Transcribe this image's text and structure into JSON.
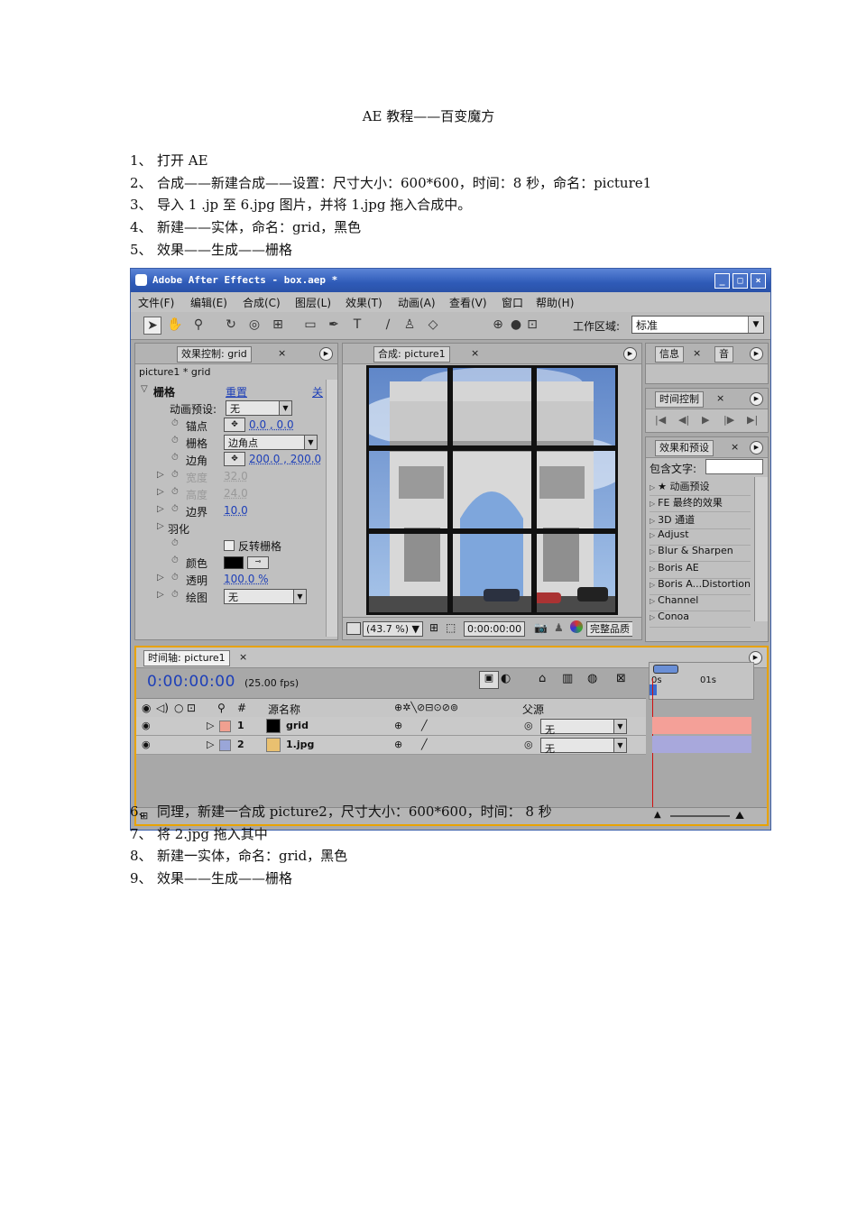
{
  "doc": {
    "title": "AE 教程——百变魔方",
    "steps_top": [
      {
        "num": "1、",
        "text": "打开 AE"
      },
      {
        "num": "2、",
        "text": "合成——新建合成——设置：尺寸大小：600*600，时间：8 秒，命名：picture1"
      },
      {
        "num": "3、",
        "text": "导入 1 .jp 至 6.jpg 图片，并将 1.jpg 拖入合成中。"
      },
      {
        "num": "4、",
        "text": "新建——实体，命名：grid，黑色"
      },
      {
        "num": "5、",
        "text": "效果——生成——栅格"
      }
    ],
    "steps_bottom": [
      {
        "num": "6、",
        "text": "同理，新建一合成 picture2，尺寸大小：600*600，时间： 8 秒"
      },
      {
        "num": "7、",
        "text": "将 2.jpg 拖入其中"
      },
      {
        "num": "8、",
        "text": "新建一实体，命名：grid，黑色"
      },
      {
        "num": "9、",
        "text": "效果——生成——栅格"
      }
    ]
  },
  "ae": {
    "window_title": "Adobe After Effects - box.aep *",
    "menu": [
      "文件(F)",
      "编辑(E)",
      "合成(C)",
      "图层(L)",
      "效果(T)",
      "动画(A)",
      "查看(V)",
      "窗口",
      "帮助(H)"
    ],
    "workspace_label": "工作区域:",
    "workspace_value": "标准",
    "effect_controls": {
      "tab": "效果控制: grid",
      "layer_path": "picture1 * grid",
      "effect_name": "栅格",
      "reset": "重置",
      "about": "关",
      "preset_label": "动画预设:",
      "preset_value": "无",
      "props": [
        {
          "name": "锚点",
          "value": "0.0 , 0.0",
          "dim": false
        },
        {
          "name": "栅格",
          "value": "边角点",
          "dim": false
        },
        {
          "name": "边角",
          "value": "200.0 , 200.0",
          "dim": false
        },
        {
          "name": "宽度",
          "value": "32.0",
          "dim": true
        },
        {
          "name": "高度",
          "value": "24.0",
          "dim": true
        },
        {
          "name": "边界",
          "value": "10.0",
          "dim": false
        },
        {
          "name": "羽化",
          "value": "",
          "dim": false
        },
        {
          "name": "反转栅格",
          "value": "",
          "dim": false
        },
        {
          "name": "颜色",
          "value": "",
          "dim": false
        },
        {
          "name": "透明",
          "value": "100.0 %",
          "dim": false
        },
        {
          "name": "绘图",
          "value": "无",
          "dim": false
        }
      ]
    },
    "composition": {
      "tab": "合成: picture1",
      "zoom": "(43.7 %)",
      "timecode": "0:00:00:00",
      "quality": "完整品质"
    },
    "info_tabs": [
      "信息",
      "音"
    ],
    "time_controls_tab": "时间控制",
    "effects_presets": {
      "tab": "效果和预设",
      "contains_label": "包含文字:",
      "items": [
        "★ 动画预设",
        "FE 最终的效果",
        "3D 通道",
        "Adjust",
        "Blur & Sharpen",
        "Boris AE",
        "Boris A...Distortion",
        "Channel",
        "Conoa"
      ]
    },
    "timeline": {
      "tab": "时间轴: picture1",
      "time": "0:00:00:00",
      "fps": "(25.00 fps)",
      "col_num": "#",
      "col_source": "源名称",
      "col_parent": "父源",
      "ruler_start": "0s",
      "ruler_mark": "01s",
      "layers": [
        {
          "num": "1",
          "name": "grid",
          "parent": "无",
          "label_color": "#f0a090",
          "bar_color": "#f4a098"
        },
        {
          "num": "2",
          "name": "1.jpg",
          "parent": "无",
          "label_color": "#9aa6d8",
          "bar_color": "#a8a8dc"
        }
      ]
    }
  }
}
